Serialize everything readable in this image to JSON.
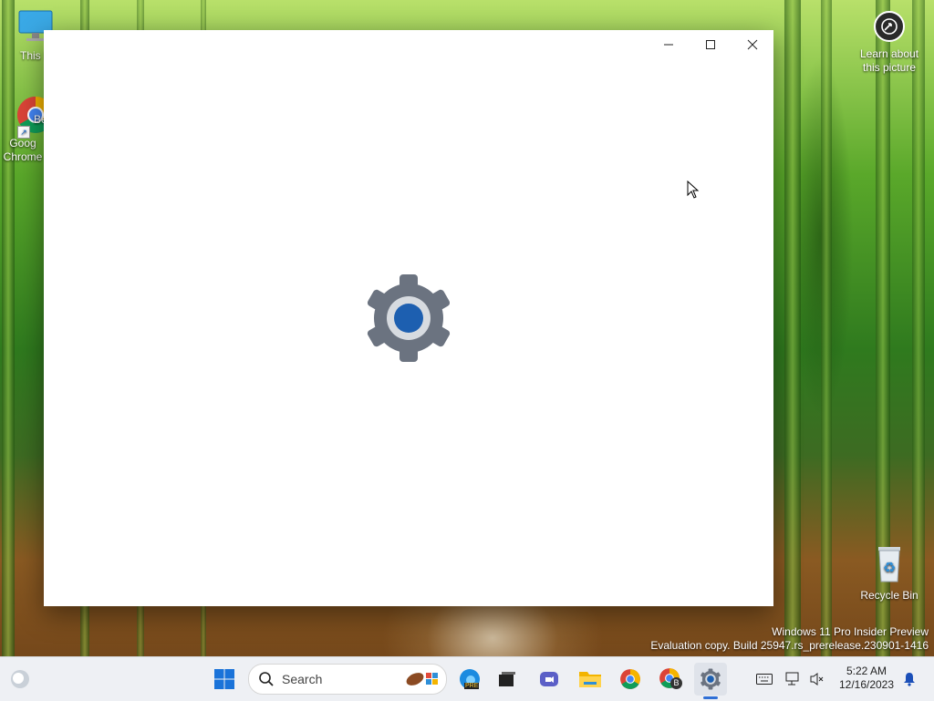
{
  "desktop": {
    "icons": [
      {
        "label": "This P"
      },
      {
        "label": "Goog Chrome"
      },
      {
        "label": "Recycle Bin"
      }
    ],
    "chrome_overlay": "Be",
    "learn": {
      "line1": "Learn about",
      "line2": "this picture"
    },
    "watermark": {
      "line1": "Windows 11 Pro Insider Preview",
      "line2": "Evaluation copy. Build 25947.rs_prerelease.230901-1416"
    }
  },
  "window": {
    "title": "",
    "splash_icon": "gear-icon"
  },
  "taskbar": {
    "search_placeholder": "Search",
    "edge_badge": "PRE",
    "chrome_badge": "B",
    "time": "5:22 AM",
    "date": "12/16/2023"
  },
  "colors": {
    "accent": "#2f6fd6",
    "gear": "#6b7380",
    "gear_center": "#1d5fb0"
  }
}
